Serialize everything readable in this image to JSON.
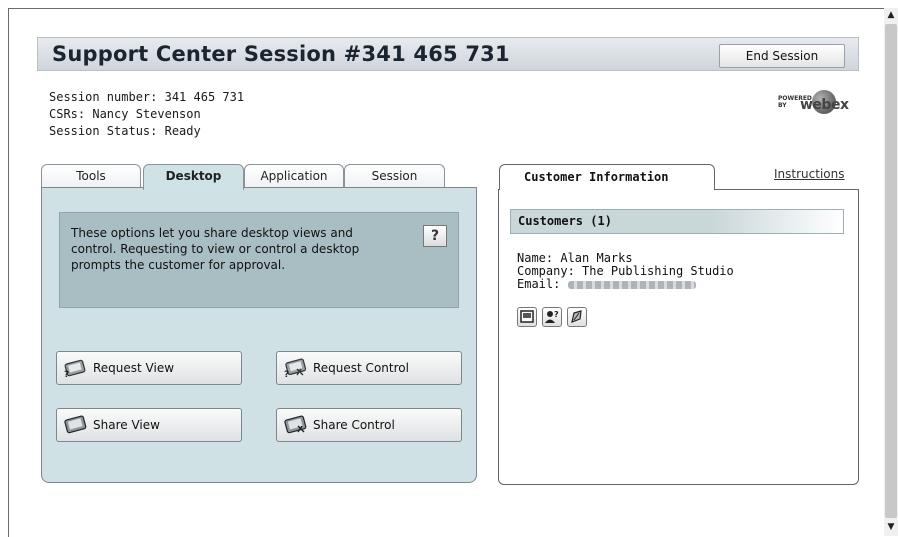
{
  "header": {
    "title": "Support Center Session #341 465 731",
    "end_session_label": "End Session"
  },
  "session": {
    "number_line": "Session number: 341 465 731",
    "csrs_line": "CSRs: Nancy Stevenson",
    "status_line": "Session Status: Ready"
  },
  "logo": {
    "powered_by": "POWERED BY",
    "brand": "webex"
  },
  "tabs": [
    {
      "label": "Tools",
      "active": false
    },
    {
      "label": "Desktop",
      "active": true
    },
    {
      "label": "Application",
      "active": false
    },
    {
      "label": "Session",
      "active": false
    }
  ],
  "desktop": {
    "description": "These options let you share desktop views and control.  Requesting to view or control a desktop prompts the customer for approval.",
    "help_label": "?",
    "actions": {
      "request_view": "Request View",
      "request_control": "Request Control",
      "share_view": "Share View",
      "share_control": "Share Control"
    }
  },
  "customer": {
    "tab_label": "Customer Information",
    "instructions_link": "Instructions",
    "customers_header": "Customers (1)",
    "name_line": "Name: Alan Marks",
    "company_line": "Company: The Publishing Studio",
    "email_label": "Email:",
    "icons": [
      "chat-icon",
      "customer-info-icon",
      "note-icon"
    ]
  },
  "scrollbar": {
    "up": "▲",
    "down": "▼"
  },
  "colors": {
    "panel_bg": "#cfe1e5",
    "desc_box": "#a8bec3",
    "header_bg": "#d9dee4"
  }
}
